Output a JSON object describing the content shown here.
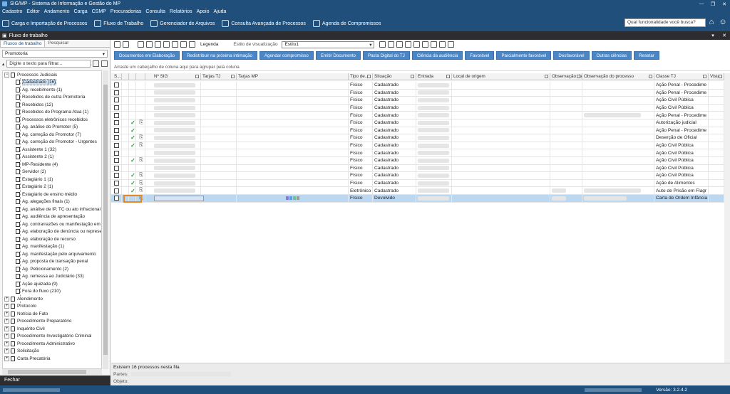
{
  "window": {
    "title": "SIG/MP - Sistema de Informação e Gestão do MP",
    "controls": [
      "—",
      "❐",
      "✕"
    ]
  },
  "menu": [
    "Cadastro",
    "Editor",
    "Andamento",
    "Carga",
    "CSMP",
    "Procuradorias",
    "Consulta",
    "Relatórios",
    "Apoio",
    "Ajuda"
  ],
  "toolbar": [
    {
      "label": "Carga e Importação de Processos",
      "icon": "download-icon"
    },
    {
      "label": "Fluxo de Trabalho",
      "icon": "flow-icon"
    },
    {
      "label": "Gerenciador de Arquivos",
      "icon": "folder-icon"
    },
    {
      "label": "Consulta Avançada de Processos",
      "icon": "search-icon"
    },
    {
      "label": "Agenda de Compromissos",
      "icon": "calendar-icon"
    }
  ],
  "search": {
    "placeholder": "Qual funcionalidade você busca?"
  },
  "panel": {
    "title": "Fluxo de trabalho",
    "controls": [
      "▾",
      "✕"
    ]
  },
  "left": {
    "tabs": [
      "Fluxos de trabalho",
      "Pesquisar"
    ],
    "dropdown": "Promotoria",
    "filter_placeholder": "Digite o texto para filtrar...",
    "tree": [
      {
        "label": "Processos Judiciais",
        "level": 0,
        "expanded": true
      },
      {
        "label": "Cadastrado (16)",
        "level": 1,
        "selected": true
      },
      {
        "label": "Ag. recebimento (1)",
        "level": 1
      },
      {
        "label": "Recebidos de outra Promotoria",
        "level": 1
      },
      {
        "label": "Recebidos (12)",
        "level": 1
      },
      {
        "label": "Recebidos do Programa Atua (1)",
        "level": 1
      },
      {
        "label": "Processos eletrônicos recebidos",
        "level": 1
      },
      {
        "label": "Ag. análise do Promotor (5)",
        "level": 1
      },
      {
        "label": "Ag. correção do Promotor (7)",
        "level": 1
      },
      {
        "label": "Ag. correção do Promotor - Urgentes",
        "level": 1
      },
      {
        "label": "Assistente 1 (32)",
        "level": 1
      },
      {
        "label": "Assistente 2 (1)",
        "level": 1
      },
      {
        "label": "MP-Residente (4)",
        "level": 1
      },
      {
        "label": "Servidor (2)",
        "level": 1
      },
      {
        "label": "Estagiário 1 (1)",
        "level": 1
      },
      {
        "label": "Estagiário 2 (1)",
        "level": 1
      },
      {
        "label": "Estagiário de ensino médio",
        "level": 1
      },
      {
        "label": "Ag. alegações finais (1)",
        "level": 1
      },
      {
        "label": "Ag. análise de IP, TC ou ato infracional",
        "level": 1
      },
      {
        "label": "Ag. audiência de apresentação",
        "level": 1
      },
      {
        "label": "Ag. contrarrazões ou manifestação em",
        "level": 1
      },
      {
        "label": "Ag. elaboração de denúncia ou represe",
        "level": 1
      },
      {
        "label": "Ag. elaboração de recurso",
        "level": 1
      },
      {
        "label": "Ag. manifestação (1)",
        "level": 1
      },
      {
        "label": "Ag. manifestação pelo arquivamento",
        "level": 1
      },
      {
        "label": "Ag. proposta de transação penal",
        "level": 1
      },
      {
        "label": "Ag. Peticionamento (2)",
        "level": 1
      },
      {
        "label": "Ag. remessa ao Judiciário (33)",
        "level": 1
      },
      {
        "label": "Ação ajuizada (9)",
        "level": 1
      },
      {
        "label": "Fora do fluxo (210)",
        "level": 1
      },
      {
        "label": "Atendimento",
        "level": 0
      },
      {
        "label": "Protocolo",
        "level": 0
      },
      {
        "label": "Notícia de Fato",
        "level": 0
      },
      {
        "label": "Procedimento Preparatório",
        "level": 0
      },
      {
        "label": "Inquérito Civil",
        "level": 0
      },
      {
        "label": "Procedimento Investigatório Criminal",
        "level": 0
      },
      {
        "label": "Procedimento Administrativo",
        "level": 0
      },
      {
        "label": "Solicitação",
        "level": 0
      },
      {
        "label": "Carta Precatória",
        "level": 0
      }
    ],
    "close_label": "Fechar"
  },
  "content": {
    "legend_label": "Legenda",
    "estilo_label": "Estilo de visualização",
    "estilo_value": "Estilo1",
    "buttons": [
      "Documentos em Elaboração",
      "Redistribuir na próxima intimação",
      "Agendar compromisso",
      "Emitir Documento",
      "Pasta Digital do TJ",
      "Ciência da audiência",
      "Favorável",
      "Parcialmente favorável",
      "Desfavorável",
      "Outras ciências",
      "Resetar"
    ],
    "group_hint": "Arraste um cabeçalho de coluna aqui para agrupar pela coluna",
    "columns": [
      "S...",
      "",
      "",
      "",
      "Nº SIG",
      "Tarjas TJ",
      "Tarjas MP",
      "Tipo de...",
      "Situação",
      "Entrada",
      "Local de origem",
      "Observação da f...",
      "Observação do processo",
      "Classe TJ",
      "Vista"
    ],
    "rows": [
      {
        "tick": false,
        "clip": false,
        "tipo": "Físico",
        "situacao": "Cadastrado",
        "classe": "Ação Penal - Procedime",
        "obs": false
      },
      {
        "tick": false,
        "clip": false,
        "tipo": "Físico",
        "situacao": "Cadastrado",
        "classe": "Ação Penal - Procedime",
        "obs": false
      },
      {
        "tick": false,
        "clip": false,
        "tipo": "Físico",
        "situacao": "Cadastrado",
        "classe": "Ação Civil Pública",
        "obs": false
      },
      {
        "tick": false,
        "clip": false,
        "tipo": "Físico",
        "situacao": "Cadastrado",
        "classe": "Ação Civil Pública",
        "obs": false
      },
      {
        "tick": false,
        "clip": false,
        "tipo": "Físico",
        "situacao": "Cadastrado",
        "classe": "Ação Penal - Procedime",
        "obs": true
      },
      {
        "tick": true,
        "clip": true,
        "tipo": "Físico",
        "situacao": "Cadastrado",
        "classe": "Autorização judicial",
        "obs": false
      },
      {
        "tick": true,
        "clip": false,
        "tipo": "Físico",
        "situacao": "Cadastrado",
        "classe": "Ação Penal - Procedime",
        "obs": false
      },
      {
        "tick": true,
        "clip": true,
        "tipo": "Físico",
        "situacao": "Cadastrado",
        "classe": "Deserção de Oficial",
        "obs": false
      },
      {
        "tick": true,
        "clip": true,
        "tipo": "Físico",
        "situacao": "Cadastrado",
        "classe": "Ação Civil Pública",
        "obs": false
      },
      {
        "tick": false,
        "clip": false,
        "tipo": "Físico",
        "situacao": "Cadastrado",
        "classe": "Ação Civil Pública",
        "obs": false
      },
      {
        "tick": true,
        "clip": true,
        "tipo": "Físico",
        "situacao": "Cadastrado",
        "classe": "Ação Civil Pública",
        "obs": false
      },
      {
        "tick": false,
        "clip": false,
        "tipo": "Físico",
        "situacao": "Cadastrado",
        "classe": "Ação Civil Pública",
        "obs": false
      },
      {
        "tick": true,
        "clip": true,
        "tipo": "Físico",
        "situacao": "Cadastrado",
        "classe": "Ação Civil Pública",
        "obs": false
      },
      {
        "tick": true,
        "clip": true,
        "tipo": "Físico",
        "situacao": "Cadastrado",
        "classe": "Ação de Alimentos",
        "obs": false
      },
      {
        "tick": true,
        "clip": true,
        "tipo": "Eletrônico",
        "situacao": "Cadastrado",
        "classe": "Auto de Prisão em Flagr",
        "obs": true
      },
      {
        "tick": false,
        "clip": true,
        "tipo": "Físico",
        "situacao": "Devolvido",
        "classe": "Carta de Ordem Infância",
        "obs": true,
        "selected": true
      }
    ],
    "tarja_colors": [
      "#8a7ad8",
      "#5aa0e8",
      "#6fc0a0",
      "#9a9a9a"
    ],
    "footer": {
      "count": "Existem 16 processos nesta fila",
      "partes_label": "Partes:",
      "objeto_label": "Objeto:"
    }
  },
  "status": {
    "version": "Versão: 3.2.4.2"
  },
  "colors": {
    "title_bg": "#1f4f7a",
    "button_bg": "#4a86c5",
    "tick": "#2e9d3a",
    "focus": "#e08a2a",
    "selected_row": "#bcd7f0"
  }
}
